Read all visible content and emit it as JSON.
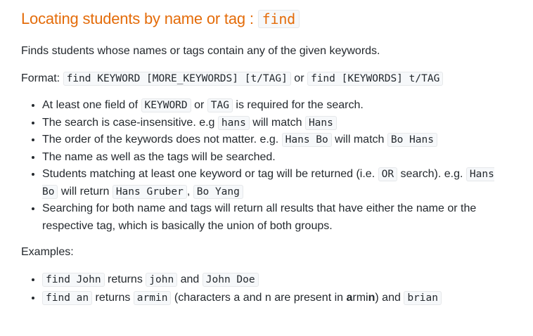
{
  "section": {
    "title": "Locating students by name or tag : ",
    "title_code": "find",
    "intro": "Finds students whose names or tags contain any of the given keywords.",
    "format_label": "Format: ",
    "format_code_1": "find KEYWORD [MORE_KEYWORDS] [t/TAG]",
    "format_or": " or ",
    "format_code_2": "find [KEYWORDS] t/TAG"
  },
  "notes": {
    "n1": {
      "t1": "At least one field of ",
      "c1": "KEYWORD",
      "t2": " or ",
      "c2": "TAG",
      "t3": " is required for the search."
    },
    "n2": {
      "t1": "The search is case-insensitive. e.g ",
      "c1": "hans",
      "t2": " will match ",
      "c2": "Hans"
    },
    "n3": {
      "t1": "The order of the keywords does not matter. e.g. ",
      "c1": "Hans Bo",
      "t2": " will match ",
      "c2": "Bo Hans"
    },
    "n4": {
      "t1": "The name as well as the tags will be searched."
    },
    "n5": {
      "t1": "Students matching at least one keyword or tag will be returned (i.e. ",
      "c1": "OR",
      "t2": " search). e.g. ",
      "c2": "Hans Bo",
      "t3": " will return ",
      "c3": "Hans Gruber",
      "t4": ", ",
      "c4": "Bo Yang"
    },
    "n6": {
      "t1": "Searching for both name and tags will return all results that have either the name or the respective tag, which is basically the union of both groups."
    }
  },
  "examples": {
    "label": "Examples:",
    "e1": {
      "c1": "find John",
      "t1": " returns ",
      "c2": "john",
      "t2": " and ",
      "c3": "John Doe"
    },
    "e2": {
      "c1": "find an",
      "t1": " returns ",
      "c2": "armin",
      "t2": " (characters a and n are present in ",
      "b1": "a",
      "t3": "rmi",
      "b2": "n",
      "t4": ") and ",
      "c3": "brian"
    }
  }
}
